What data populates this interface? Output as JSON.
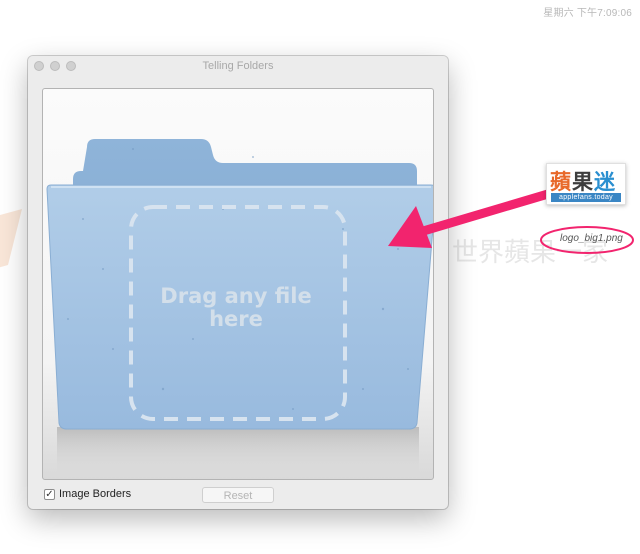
{
  "menubar": {
    "clock": "星期六 下午7:09:06"
  },
  "window": {
    "title": "Telling Folders",
    "drop_label": "Drag any file here"
  },
  "controls": {
    "image_borders_label": "Image Borders",
    "image_borders_checked": true,
    "reset_label": "Reset"
  },
  "desktop": {
    "file_name": "logo_big1.png",
    "logo_cn": [
      "蘋",
      "果",
      "迷"
    ],
    "logo_en": "applefans.today",
    "watermark_text": "世界蘋果一家"
  },
  "colors": {
    "folder_blue": "#a9c6e3",
    "folder_dark": "#7ea6cf",
    "arrow_pink": "#f2246e"
  },
  "icons": {
    "close": "window-close-dot",
    "minimize": "window-minimize-dot",
    "zoom": "window-zoom-dot",
    "check": "checkmark-icon",
    "arrow": "pointer-arrow-icon",
    "folder": "folder-icon"
  }
}
